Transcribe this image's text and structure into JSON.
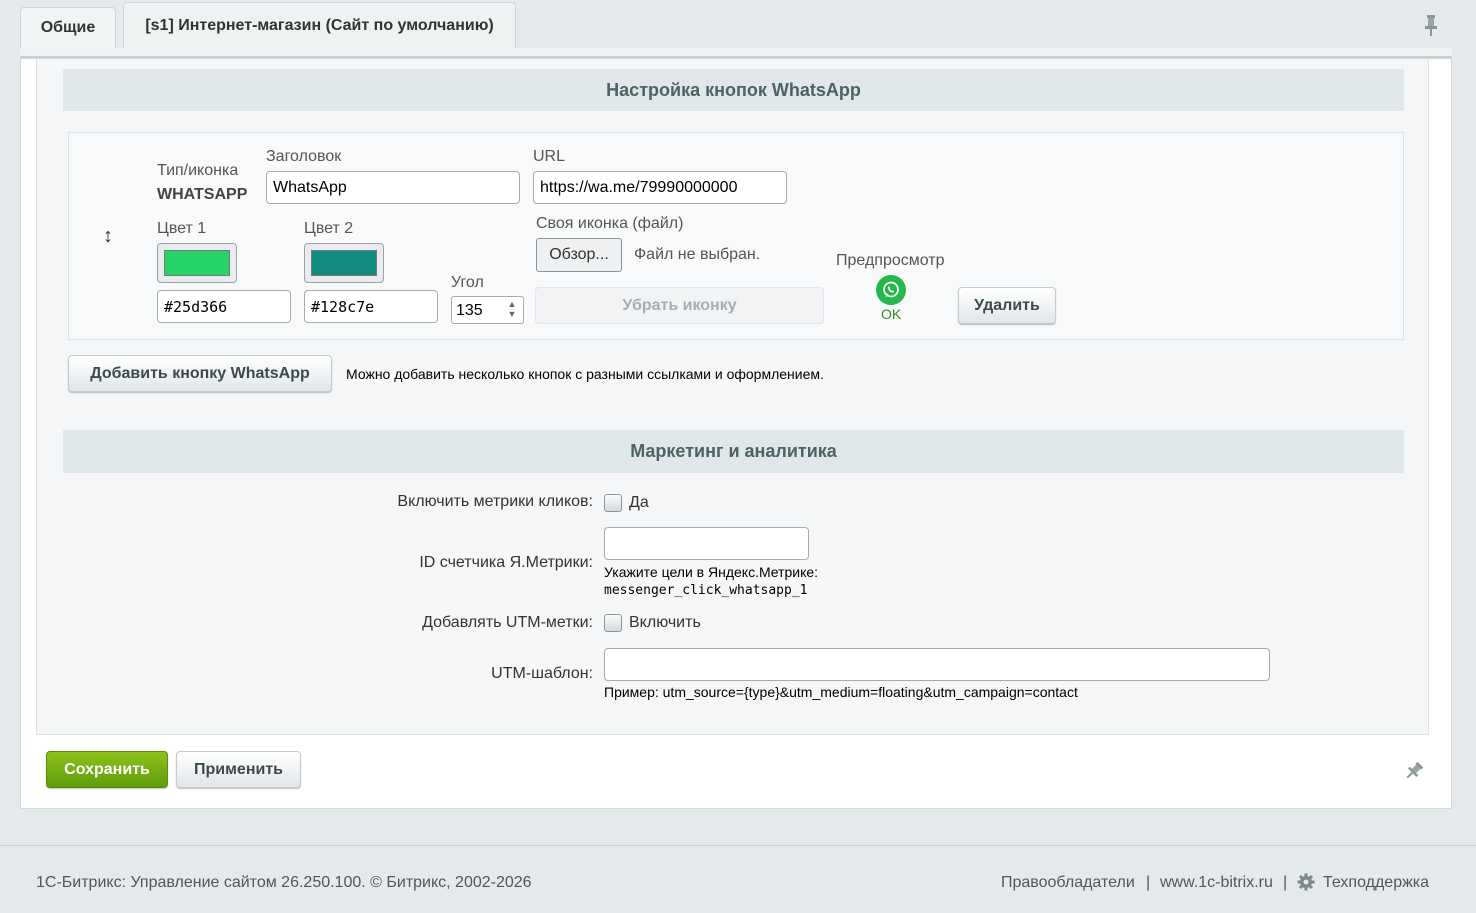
{
  "tabs": {
    "general": "Общие",
    "site": "[s1] Интернет-магазин (Сайт по умолчанию)"
  },
  "whatsapp_section": {
    "title": "Настройка кнопок WhatsApp",
    "type_label": "Тип/иконка",
    "type_value": "WHATSAPP",
    "heading_label": "Заголовок",
    "heading_value": "WhatsApp",
    "url_label": "URL",
    "url_value": "https://wa.me/79990000000",
    "color1_label": "Цвет 1",
    "color1_value": "#25d366",
    "color2_label": "Цвет 2",
    "color2_value": "#128c7e",
    "angle_label": "Угол",
    "angle_value": "135",
    "icon_file_label": "Своя иконка (файл)",
    "browse_label": "Обзор...",
    "no_file_text": "Файл не выбран.",
    "remove_icon_label": "Убрать иконку",
    "preview_label": "Предпросмотр",
    "preview_status": "OK",
    "delete_label": "Удалить",
    "add_button_label": "Добавить кнопку WhatsApp",
    "add_hint": "Можно добавить несколько кнопок с разными ссылками и оформлением.",
    "drag_handle": "↕"
  },
  "marketing_section": {
    "title": "Маркетинг и аналитика",
    "metrics_label": "Включить метрики кликов:",
    "metrics_checkbox_label": "Да",
    "metrics_checked": false,
    "ym_label": "ID счетчика Я.Метрики:",
    "ym_value": "",
    "ym_hint": "Укажите цели в Яндекс.Метрике:",
    "ym_goal": "messenger_click_whatsapp_1",
    "utm_label": "Добавлять UTM-метки:",
    "utm_checkbox_label": "Включить",
    "utm_checked": false,
    "utm_template_label": "UTM-шаблон:",
    "utm_template_value": "",
    "utm_example": "Пример: utm_source={type}&utm_medium=floating&utm_campaign=contact"
  },
  "actions": {
    "save_label": "Сохранить",
    "apply_label": "Применить"
  },
  "footer": {
    "copyright": "1С-Битрикс: Управление сайтом 26.250.100. © Битрикс, 2002-2026",
    "rights_link": "Правообладатели",
    "sep": "|",
    "site_link": "www.1c-bitrix.ru",
    "support_link": "Техподдержка"
  },
  "colors": {
    "accent_green": "#6aab12",
    "whatsapp_green": "#25d366",
    "whatsapp_teal": "#128c7e"
  },
  "icons": [
    "pin-icon",
    "drag-handle-icon",
    "whatsapp-icon",
    "gear-icon"
  ]
}
